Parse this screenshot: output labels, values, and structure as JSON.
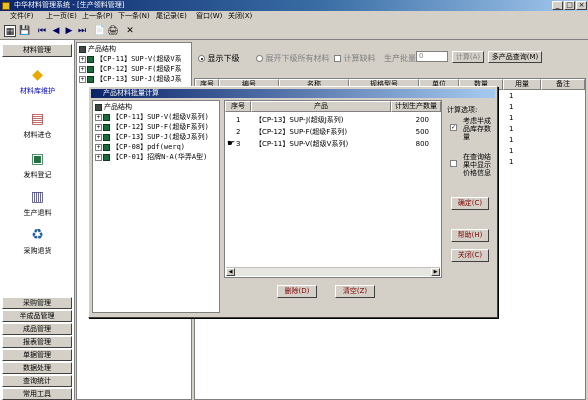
{
  "window": {
    "title": "中华材料管理系统 - [生产领料管理]",
    "min": "_",
    "max": "□",
    "close": "×"
  },
  "menu": [
    "文件(F)",
    "上一页(E)",
    "上一条(P)",
    "下一条(N)",
    "尾记录(E)",
    "窗口(W)",
    "关闭(X)"
  ],
  "toolbar": {
    "icons": [
      "grid-icon",
      "save-icon",
      "first-icon",
      "prev-icon",
      "next-icon",
      "last-icon",
      "page-icon",
      "print-icon",
      "delete-icon"
    ]
  },
  "left": {
    "header": "材料管理",
    "nav": [
      {
        "label": "材料库维护",
        "icon": "diamond-icon"
      },
      {
        "label": "材料进仓",
        "icon": "inbox-icon"
      },
      {
        "label": "发料登记",
        "icon": "clipboard-icon"
      },
      {
        "label": "生产退料",
        "icon": "return-icon"
      },
      {
        "label": "采购退货",
        "icon": "cycle-icon"
      }
    ],
    "bottom": [
      "采购管理",
      "半成品管理",
      "成品管理",
      "报表管理",
      "单据管理",
      "数据处理",
      "查询统计",
      "常用工具"
    ]
  },
  "main_tree": {
    "root": "产品结构",
    "items": [
      "【CP-11】SUP-V(超级V系",
      "【CP-12】SUP-F(超级F系",
      "【CP-13】SUP-J(超级J系"
    ]
  },
  "options": {
    "radio1": "显示下级",
    "radio2": "展开下级所有材料",
    "check1": "计算缺料",
    "batch_label": "生产批量",
    "batch_value": "0",
    "calc_btn": "计算(A)",
    "multi_btn": "多产品查询(M)"
  },
  "main_grid": {
    "headers": [
      "序号",
      "编号",
      "名称",
      "规格型号",
      "单位",
      "数量",
      "用量",
      "备注"
    ],
    "rows": [
      "1",
      "1",
      "1",
      "1",
      "1",
      "1",
      "1"
    ]
  },
  "dialog": {
    "title": "产品材料批量计算",
    "tree_root": "产品结构",
    "tree_items": [
      "【CP-11】SUP-V(超级V系列)",
      "【CP-12】SUP-F(超级F系列)",
      "【CP-13】SUP-J(超级J系列)",
      "【CP-08】pdf(werq)",
      "【CP-01】招牌N-A(华弄A型)"
    ],
    "headers": [
      "序号",
      "产品",
      "计划生产数量"
    ],
    "rows": [
      {
        "seq": "1",
        "product": "【CP-13】SUP-J(超级J系列)",
        "qty": "200"
      },
      {
        "seq": "2",
        "product": "【CP-12】SUP-F(超级F系列)",
        "qty": "500"
      },
      {
        "seq": "3",
        "product": "【CP-11】SUP-V(超级V系列)",
        "qty": "800"
      }
    ],
    "options_label": "计算选项:",
    "opt1": "考虑半成品库存数量",
    "opt2": "在查询结果中显示价格信息",
    "confirm": "确定(C)",
    "help": "帮助(H)",
    "close": "关闭(C)",
    "delete": "删除(D)",
    "clear": "清空(Z)"
  }
}
